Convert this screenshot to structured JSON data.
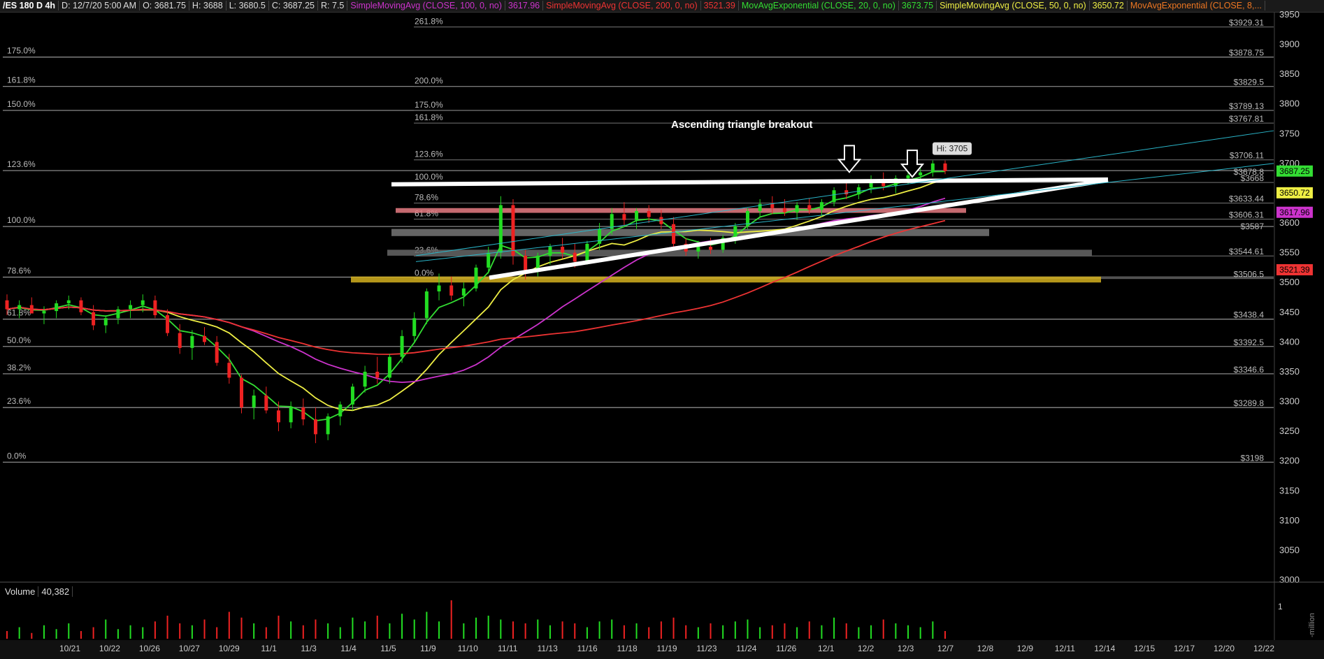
{
  "header": {
    "symbol": "/ES 180 D 4h",
    "date": "D: 12/7/20 5:00 AM",
    "open": "O: 3681.75",
    "high": "H: 3688",
    "low": "L: 3680.5",
    "close": "C: 3687.25",
    "range": "R: 7.5",
    "indicators": [
      {
        "label": "SimpleMovingAvg (CLOSE, 100, 0, no)",
        "value": "3617.96",
        "color": "#cc33cc"
      },
      {
        "label": "SimpleMovingAvg (CLOSE, 200, 0, no)",
        "value": "3521.39",
        "color": "#ee3333"
      },
      {
        "label": "MovAvgExponential (CLOSE, 20, 0, no)",
        "value": "3673.75",
        "color": "#33dd33"
      },
      {
        "label": "SimpleMovingAvg (CLOSE, 50, 0, no)",
        "value": "3650.72",
        "color": "#eeee44"
      },
      {
        "label": "MovAvgExponential (CLOSE, 8,...",
        "value": "",
        "color": "#ee7722"
      }
    ]
  },
  "chart_data": {
    "type": "candlestick",
    "annotation": "Ascending triangle breakout",
    "high_label": "Hi: 3705",
    "y_ticks": [
      3950,
      3900,
      3850,
      3800,
      3750,
      3700,
      3650,
      3600,
      3550,
      3500,
      3450,
      3400,
      3350,
      3300,
      3250,
      3200,
      3150,
      3100,
      3050,
      3000
    ],
    "y_tick_labels": [
      "3950",
      "3900",
      "3850",
      "3800",
      "3750",
      "3700",
      "3650",
      "3600",
      "3550",
      "3500",
      "3450",
      "3400",
      "3350",
      "3300",
      "3250",
      "3200",
      "3150",
      "3100",
      "3050",
      "3000"
    ],
    "x_labels": [
      "10/21",
      "10/22",
      "10/26",
      "10/27",
      "10/29",
      "11/1",
      "11/3",
      "11/4",
      "11/5",
      "11/9",
      "11/10",
      "11/11",
      "11/13",
      "11/16",
      "11/18",
      "11/19",
      "11/23",
      "11/24",
      "11/26",
      "12/1",
      "12/2",
      "12/3",
      "12/7",
      "12/8",
      "12/9",
      "12/11",
      "12/14",
      "12/15",
      "12/17",
      "12/20",
      "12/22"
    ],
    "price_badges": [
      {
        "value": 3687.25,
        "label": "3687.25",
        "color": "#33dd33"
      },
      {
        "value": 3650.72,
        "label": "3650.72",
        "color": "#eeee44"
      },
      {
        "value": 3617.96,
        "label": "3617.96",
        "color": "#cc33cc"
      },
      {
        "value": 3521.39,
        "label": "3521.39",
        "color": "#ee3333"
      }
    ],
    "fib_left": [
      {
        "label": "175.0%",
        "value": 3878.75
      },
      {
        "label": "161.8%",
        "value": 3829.5
      },
      {
        "label": "150.0%",
        "value": 3789.13
      },
      {
        "label": "123.6%",
        "value": 3688
      },
      {
        "label": "100.0%",
        "value": 3594
      },
      {
        "label": "78.6%",
        "value": 3509
      },
      {
        "label": "61.8%",
        "value": 3438.4
      },
      {
        "label": "50.0%",
        "value": 3392.5
      },
      {
        "label": "38.2%",
        "value": 3346.6
      },
      {
        "label": "23.6%",
        "value": 3289.8
      },
      {
        "label": "0.0%",
        "value": 3198
      }
    ],
    "fib_right": [
      {
        "label": "261.8%",
        "value": 3929.31
      },
      {
        "label": "200.0%",
        "value": 3829.5
      },
      {
        "label": "175.0%",
        "value": 3789.13
      },
      {
        "label": "161.8%",
        "value": 3767.81
      },
      {
        "label": "123.6%",
        "value": 3706.11
      },
      {
        "label": "100.0%",
        "value": 3668
      },
      {
        "label": "78.6%",
        "value": 3633.44
      },
      {
        "label": "61.8%",
        "value": 3606.31
      },
      {
        "label": "23.6%",
        "value": 3544.61
      },
      {
        "label": "0.0%",
        "value": 3506.5
      }
    ],
    "right_levels": [
      "$3929.31",
      "$3878.75",
      "$3829.5",
      "$3789.13",
      "$3767.81",
      "$3706.11",
      "$3678.8",
      "$3668",
      "$3633.44",
      "$3606.31",
      "$3587",
      "$3544.61",
      "$3506.5",
      "$3438.4",
      "$3392.5",
      "$3346.6",
      "$3289.8",
      "$3198"
    ],
    "ohlc": [
      [
        3470,
        3480,
        3445,
        3455
      ],
      [
        3455,
        3470,
        3440,
        3462
      ],
      [
        3462,
        3475,
        3450,
        3448
      ],
      [
        3448,
        3460,
        3430,
        3452
      ],
      [
        3452,
        3470,
        3440,
        3465
      ],
      [
        3465,
        3478,
        3455,
        3470
      ],
      [
        3470,
        3475,
        3445,
        3450
      ],
      [
        3450,
        3462,
        3420,
        3428
      ],
      [
        3428,
        3445,
        3415,
        3440
      ],
      [
        3440,
        3460,
        3430,
        3455
      ],
      [
        3455,
        3470,
        3440,
        3462
      ],
      [
        3462,
        3480,
        3450,
        3470
      ],
      [
        3470,
        3478,
        3440,
        3445
      ],
      [
        3445,
        3455,
        3410,
        3415
      ],
      [
        3415,
        3430,
        3380,
        3390
      ],
      [
        3390,
        3420,
        3370,
        3410
      ],
      [
        3410,
        3425,
        3395,
        3400
      ],
      [
        3400,
        3410,
        3360,
        3365
      ],
      [
        3365,
        3380,
        3330,
        3340
      ],
      [
        3340,
        3345,
        3280,
        3290
      ],
      [
        3290,
        3320,
        3270,
        3310
      ],
      [
        3310,
        3325,
        3280,
        3285
      ],
      [
        3285,
        3300,
        3250,
        3265
      ],
      [
        3265,
        3300,
        3255,
        3290
      ],
      [
        3290,
        3305,
        3260,
        3270
      ],
      [
        3270,
        3290,
        3230,
        3245
      ],
      [
        3245,
        3280,
        3235,
        3275
      ],
      [
        3275,
        3300,
        3260,
        3295
      ],
      [
        3295,
        3330,
        3285,
        3325
      ],
      [
        3325,
        3360,
        3315,
        3350
      ],
      [
        3350,
        3375,
        3330,
        3340
      ],
      [
        3340,
        3380,
        3330,
        3375
      ],
      [
        3375,
        3420,
        3365,
        3410
      ],
      [
        3410,
        3450,
        3400,
        3440
      ],
      [
        3440,
        3490,
        3430,
        3485
      ],
      [
        3485,
        3515,
        3470,
        3495
      ],
      [
        3495,
        3510,
        3470,
        3478
      ],
      [
        3478,
        3500,
        3460,
        3490
      ],
      [
        3490,
        3530,
        3485,
        3525
      ],
      [
        3525,
        3560,
        3515,
        3550
      ],
      [
        3550,
        3645,
        3540,
        3630
      ],
      [
        3630,
        3640,
        3530,
        3545
      ],
      [
        3545,
        3555,
        3505,
        3520
      ],
      [
        3520,
        3550,
        3510,
        3545
      ],
      [
        3545,
        3565,
        3530,
        3560
      ],
      [
        3560,
        3575,
        3540,
        3550
      ],
      [
        3550,
        3565,
        3525,
        3535
      ],
      [
        3535,
        3570,
        3530,
        3565
      ],
      [
        3565,
        3600,
        3555,
        3590
      ],
      [
        3590,
        3625,
        3580,
        3615
      ],
      [
        3615,
        3635,
        3595,
        3605
      ],
      [
        3605,
        3625,
        3590,
        3620
      ],
      [
        3620,
        3630,
        3600,
        3610
      ],
      [
        3610,
        3622,
        3590,
        3598
      ],
      [
        3598,
        3610,
        3560,
        3565
      ],
      [
        3565,
        3575,
        3545,
        3552
      ],
      [
        3552,
        3570,
        3540,
        3560
      ],
      [
        3560,
        3575,
        3548,
        3555
      ],
      [
        3555,
        3580,
        3550,
        3575
      ],
      [
        3575,
        3600,
        3565,
        3595
      ],
      [
        3595,
        3625,
        3590,
        3620
      ],
      [
        3620,
        3640,
        3610,
        3632
      ],
      [
        3632,
        3645,
        3615,
        3625
      ],
      [
        3625,
        3640,
        3612,
        3618
      ],
      [
        3618,
        3635,
        3605,
        3630
      ],
      [
        3630,
        3642,
        3615,
        3622
      ],
      [
        3622,
        3640,
        3610,
        3635
      ],
      [
        3635,
        3660,
        3628,
        3655
      ],
      [
        3655,
        3670,
        3640,
        3648
      ],
      [
        3648,
        3665,
        3640,
        3660
      ],
      [
        3660,
        3680,
        3650,
        3672
      ],
      [
        3672,
        3685,
        3655,
        3662
      ],
      [
        3662,
        3680,
        3650,
        3675
      ],
      [
        3675,
        3690,
        3665,
        3680
      ],
      [
        3680,
        3692,
        3668,
        3685
      ],
      [
        3685,
        3705,
        3678,
        3700
      ],
      [
        3700,
        3705,
        3682,
        3687
      ]
    ],
    "volume": [
      0.2,
      0.3,
      0.15,
      0.35,
      0.25,
      0.4,
      0.2,
      0.3,
      0.5,
      0.25,
      0.35,
      0.3,
      0.45,
      0.6,
      0.4,
      0.35,
      0.5,
      0.3,
      0.7,
      0.55,
      0.4,
      0.3,
      0.6,
      0.45,
      0.35,
      0.5,
      0.4,
      0.3,
      0.55,
      0.45,
      0.6,
      0.4,
      0.65,
      0.5,
      0.7,
      0.45,
      1.0,
      0.4,
      0.55,
      0.6,
      0.5,
      0.45,
      0.4,
      0.5,
      0.35,
      0.45,
      0.4,
      0.3,
      0.45,
      0.5,
      0.35,
      0.4,
      0.3,
      0.45,
      0.55,
      0.35,
      0.3,
      0.4,
      0.35,
      0.45,
      0.5,
      0.3,
      0.35,
      0.4,
      0.3,
      0.45,
      0.35,
      0.55,
      0.4,
      0.3,
      0.35,
      0.5,
      0.4,
      0.35,
      0.3,
      0.45,
      0.2
    ],
    "volume_label": "Volume",
    "volume_value": "40,382",
    "volume_scale": "1",
    "volume_unit": "-million"
  }
}
